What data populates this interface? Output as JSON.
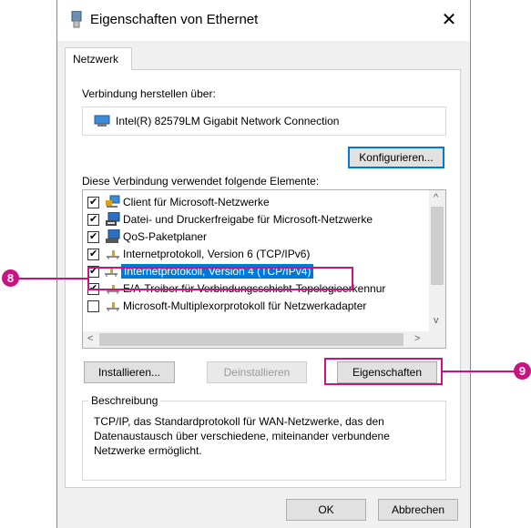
{
  "window": {
    "title": "Eigenschaften von Ethernet",
    "close_label": "✕"
  },
  "tabs": [
    {
      "label": "Netzwerk"
    }
  ],
  "connect_via": {
    "label": "Verbindung herstellen über:",
    "adapter": "Intel(R) 82579LM Gigabit Network Connection"
  },
  "buttons": {
    "configure": "Konfigurieren...",
    "install": "Installieren...",
    "uninstall": "Deinstallieren",
    "properties": "Eigenschaften",
    "ok": "OK",
    "cancel": "Abbrechen"
  },
  "elements": {
    "label": "Diese Verbindung verwendet folgende Elemente:",
    "items": [
      {
        "label": "Client für Microsoft-Netzwerke",
        "checked": true,
        "icon": "network-client-icon"
      },
      {
        "label": "Datei- und Druckerfreigabe für Microsoft-Netzwerke",
        "checked": true,
        "icon": "printer-computer-icon"
      },
      {
        "label": "QoS-Paketplaner",
        "checked": true,
        "icon": "computer-icon"
      },
      {
        "label": "Internetprotokoll, Version 6 (TCP/IPv6)",
        "checked": true,
        "icon": "protocol-icon"
      },
      {
        "label": "Internetprotokoll, Version 4 (TCP/IPv4)",
        "checked": true,
        "icon": "protocol-icon",
        "selected": true
      },
      {
        "label": "E/A-Treiber für Verbindungsschicht-Topologieerkennur",
        "checked": true,
        "icon": "protocol-icon"
      },
      {
        "label": "Microsoft-Multiplexorprotokoll für Netzwerkadapter",
        "checked": false,
        "icon": "protocol-icon"
      }
    ]
  },
  "description": {
    "legend": "Beschreibung",
    "text": "TCP/IP, das Standardprotokoll für WAN-Netzwerke, das den Datenaustausch über verschiedene, miteinander verbundene Netzwerke ermöglicht."
  },
  "callouts": {
    "first": "8",
    "second": "9"
  },
  "colors": {
    "accent": "#c7147e",
    "selection": "#0078d7"
  }
}
